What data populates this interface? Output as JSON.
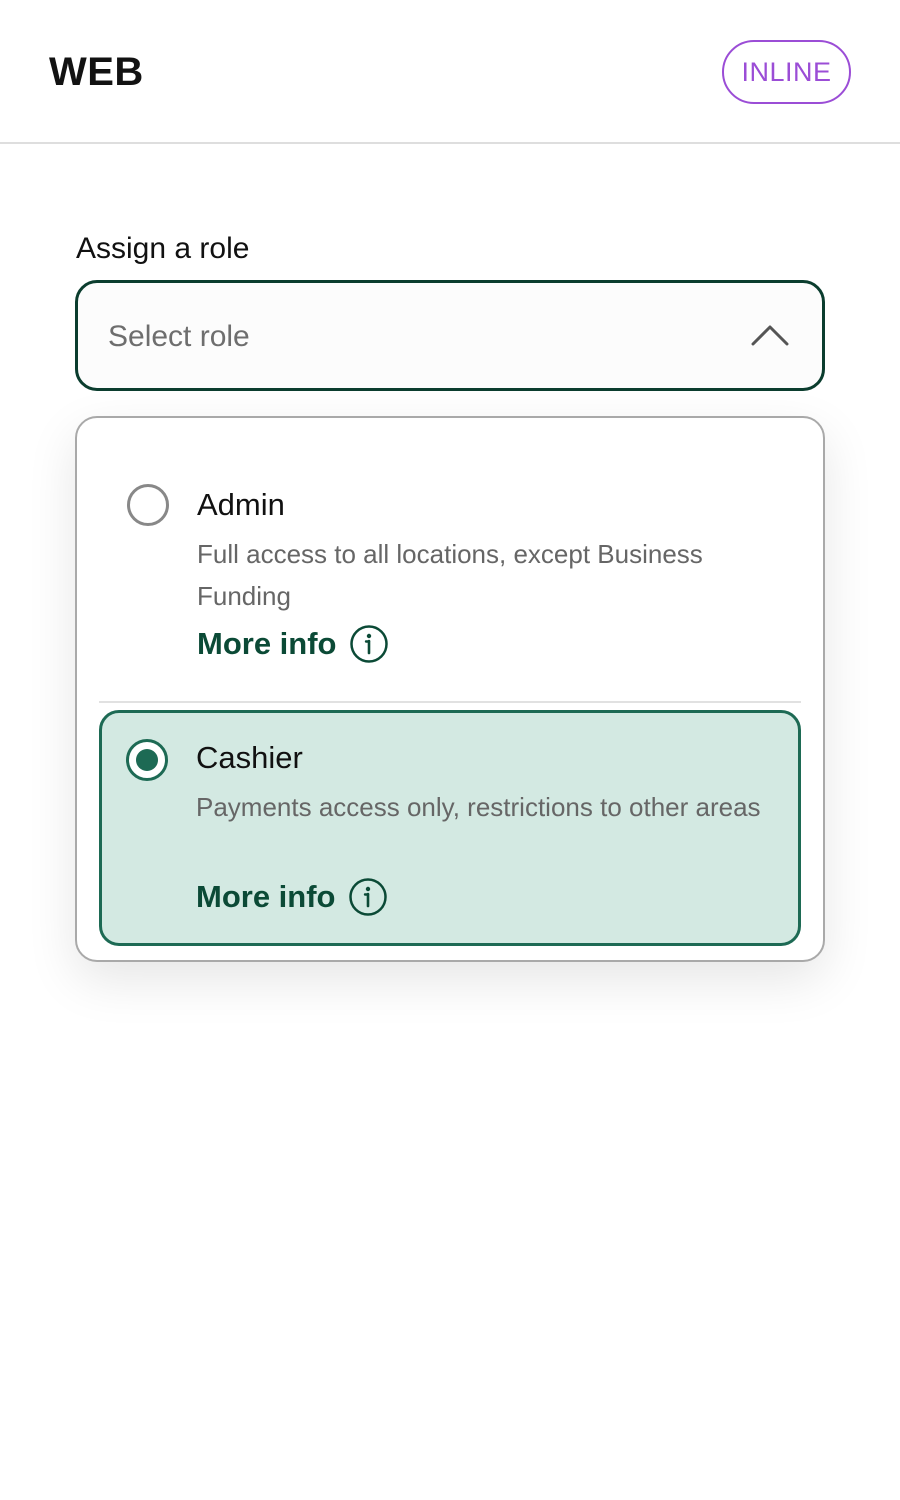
{
  "header": {
    "brand": "WEB",
    "mode_badge": "INLINE"
  },
  "form": {
    "label": "Assign a role",
    "select": {
      "placeholder": "Select role",
      "state": "expanded"
    },
    "options": [
      {
        "title": "Admin",
        "description": "Full access to all locations, except Business Funding",
        "more_info": "More info",
        "selected": false
      },
      {
        "title": "Cashier",
        "description": "Payments access only, restrictions to other areas",
        "more_info": "More info",
        "selected": true
      }
    ]
  },
  "icons": {
    "chevron": "chevron-up-icon",
    "info": "info-circle-icon"
  },
  "colors": {
    "accent": "#0b4a36",
    "selected_background": "#d3e9e2",
    "selected_border": "#1d6a54",
    "badge": "#9b4dd6"
  }
}
